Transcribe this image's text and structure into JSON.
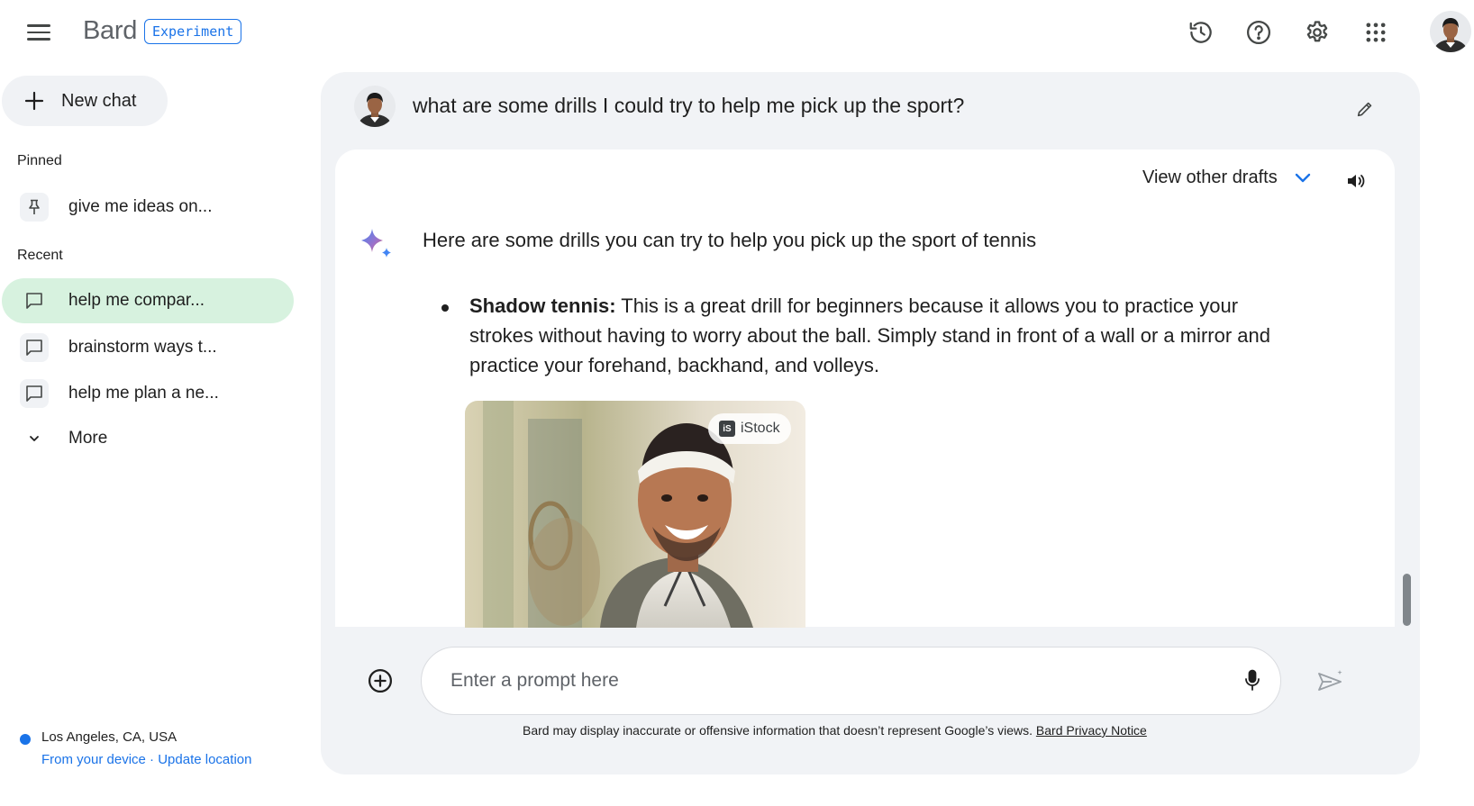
{
  "header": {
    "brand": "Bard",
    "badge": "Experiment",
    "icons": [
      "menu-icon",
      "history-icon",
      "help-icon",
      "settings-gear-icon",
      "apps-grid-icon",
      "avatar"
    ]
  },
  "sidebar": {
    "new_chat_label": "New chat",
    "pinned_label": "Pinned",
    "pinned_items": [
      {
        "label": "give me ideas on...",
        "icon": "pin-icon"
      }
    ],
    "recent_label": "Recent",
    "recent_items": [
      {
        "label": "help me compar...",
        "icon": "chat-bubble-icon",
        "active": true
      },
      {
        "label": "brainstorm ways t...",
        "icon": "chat-bubble-icon",
        "active": false
      },
      {
        "label": "help me plan a ne...",
        "icon": "chat-bubble-icon",
        "active": false
      }
    ],
    "more_label": "More",
    "location": {
      "place": "Los Angeles, CA, USA",
      "source": "From your device",
      "separator": " · ",
      "update": "Update location"
    }
  },
  "conversation": {
    "user_question": "what are some drills I could try to help me pick up the sport?",
    "view_drafts_label": "View other drafts",
    "response_intro": "Here are some drills you can try to help you pick up the sport of tennis",
    "bullets": [
      {
        "title": "Shadow tennis:",
        "text": " This is a great drill for beginners because it allows you to practice your strokes without having to worry about the ball. Simply stand in front of a wall or a mirror and practice your forehand, backhand, and volleys."
      }
    ],
    "image_source_badge": "iStock",
    "image_source_logo": "iS"
  },
  "prompt": {
    "placeholder": "Enter a prompt here",
    "disclaimer": "Bard may display inaccurate or offensive information that doesn’t represent Google’s views. ",
    "privacy_link": "Bard Privacy Notice"
  },
  "colors": {
    "accent": "#1a73e8",
    "active_item": "#d7f2df",
    "panel_bg": "#f1f3f6"
  }
}
